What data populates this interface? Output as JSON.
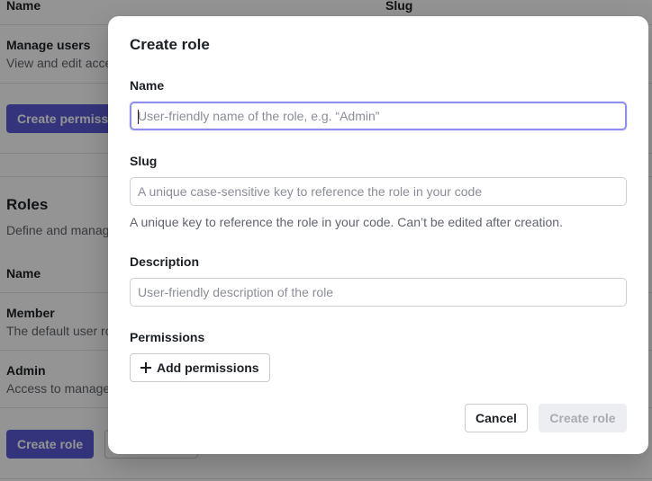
{
  "background": {
    "permissions_table": {
      "col_name": "Name",
      "col_slug": "Slug",
      "row_title": "Manage users",
      "row_desc": "View and edit access"
    },
    "create_permission_button": "Create permission",
    "roles": {
      "title": "Roles",
      "desc": "Define and manage roles",
      "col_name": "Name",
      "rows": [
        {
          "title": "Member",
          "desc": "The default user role"
        },
        {
          "title": "Admin",
          "desc": "Access to manage"
        }
      ],
      "create_role_button": "Create role"
    }
  },
  "modal": {
    "title": "Create role",
    "name": {
      "label": "Name",
      "placeholder": "User-friendly name of the role, e.g. “Admin”"
    },
    "slug": {
      "label": "Slug",
      "placeholder": "A unique case-sensitive key to reference the role in your code",
      "hint": "A unique key to reference the role in your code. Can’t be edited after creation."
    },
    "description": {
      "label": "Description",
      "placeholder": "User-friendly description of the role"
    },
    "permissions": {
      "label": "Permissions",
      "add_button": "Add permissions",
      "add_icon": "plus-icon"
    },
    "cancel_button": "Cancel",
    "create_button": "Create role"
  },
  "colors": {
    "accent": "#5b5bd6",
    "focus_ring": "#8e8ef0",
    "disabled_bg": "#eceef1",
    "disabled_text": "#a8abb3"
  }
}
